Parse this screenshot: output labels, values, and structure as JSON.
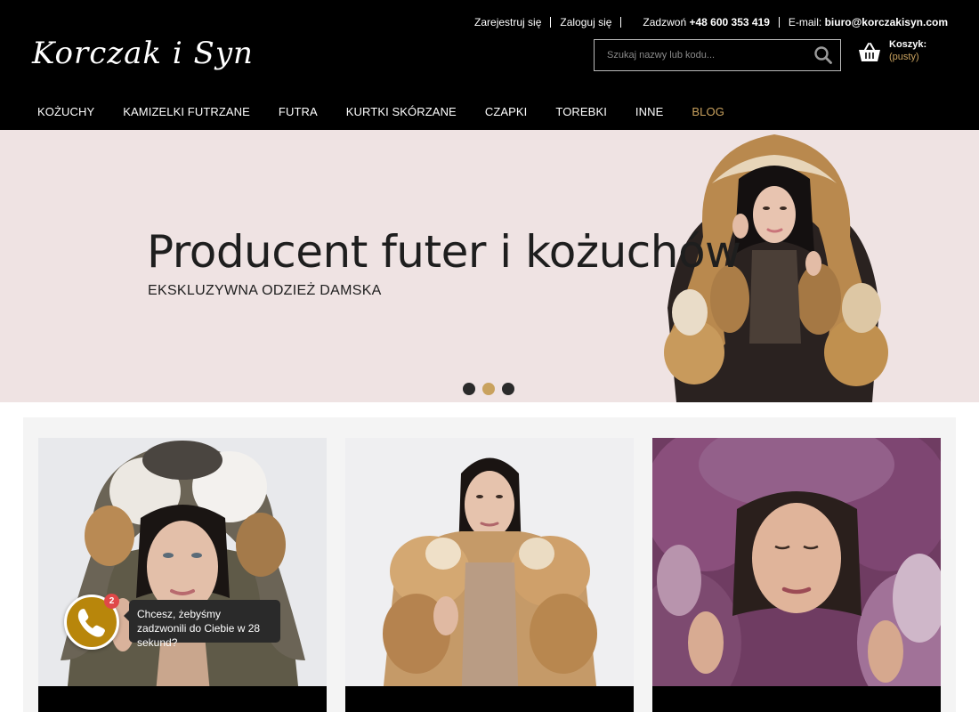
{
  "header": {
    "logo_text": "Korczak i Syn",
    "register": "Zarejestruj się",
    "login": "Zaloguj się",
    "phone_label": "Zadzwoń",
    "phone": "+48 600 353 419",
    "email_label": "E-mail:",
    "email": "biuro@korczakisyn.com",
    "search_placeholder": "Szukaj nazwy lub kodu...",
    "cart_label": "Koszyk:",
    "cart_status": "(pusty)"
  },
  "nav": {
    "items": [
      {
        "label": "KOŻUCHY"
      },
      {
        "label": "KAMIZELKI FUTRZANE"
      },
      {
        "label": "FUTRA"
      },
      {
        "label": "KURTKI SKÓRZANE"
      },
      {
        "label": "CZAPKI"
      },
      {
        "label": "TOREBKI"
      },
      {
        "label": "INNE"
      },
      {
        "label": "BLOG"
      }
    ]
  },
  "hero": {
    "title": "Producent futer i kożuchów",
    "subtitle": "EKSKLUZYWNA ODZIEŻ DAMSKA",
    "slides": 3,
    "active_slide": 2
  },
  "products": [
    {
      "image": "model-fox-fur-hood-photo"
    },
    {
      "image": "model-fox-fur-vest-photo"
    },
    {
      "image": "model-purple-fur-hood-photo"
    }
  ],
  "callback": {
    "badge": "2",
    "message": "Chcesz, żebyśmy zadzwonili do Ciebie w 28 sekund?"
  },
  "colors": {
    "header_bg": "#000000",
    "accent_gold": "#c9a25e",
    "hero_bg": "#efe3e3",
    "call_button": "#b8860b",
    "badge_red": "#e04848"
  }
}
